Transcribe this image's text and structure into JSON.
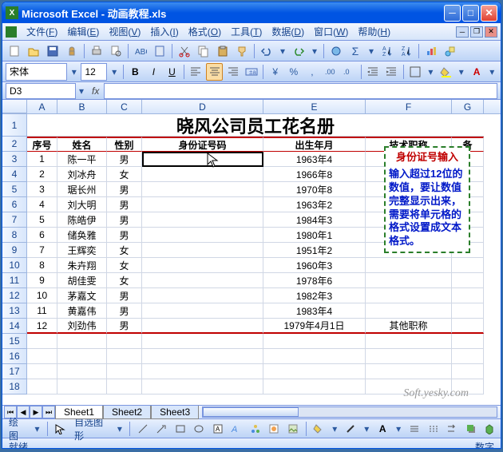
{
  "window": {
    "title": "Microsoft Excel - 动画教程.xls"
  },
  "menus": [
    {
      "label": "文件",
      "key": "F"
    },
    {
      "label": "编辑",
      "key": "E"
    },
    {
      "label": "视图",
      "key": "V"
    },
    {
      "label": "插入",
      "key": "I"
    },
    {
      "label": "格式",
      "key": "O"
    },
    {
      "label": "工具",
      "key": "T"
    },
    {
      "label": "数据",
      "key": "D"
    },
    {
      "label": "窗口",
      "key": "W"
    },
    {
      "label": "帮助",
      "key": "H"
    }
  ],
  "format": {
    "font_name": "宋体",
    "font_size": "12"
  },
  "namebox": {
    "value": "D3"
  },
  "columns": [
    "A",
    "B",
    "C",
    "D",
    "E",
    "F",
    "G"
  ],
  "col_widths": [
    "col-A",
    "col-B",
    "col-C",
    "col-D",
    "col-E",
    "col-F",
    "col-G"
  ],
  "sheet_title": "晓风公司员工花名册",
  "headers": [
    "序号",
    "姓名",
    "性别",
    "身份证号码",
    "出生年月",
    "技术职称",
    "备"
  ],
  "rows": [
    [
      "1",
      "陈一平",
      "男",
      "",
      "1963年4",
      ""
    ],
    [
      "2",
      "刘冰舟",
      "女",
      "",
      "1966年8",
      ""
    ],
    [
      "3",
      "琚长州",
      "男",
      "",
      "1970年8",
      ""
    ],
    [
      "4",
      "刘大明",
      "男",
      "",
      "1963年2",
      ""
    ],
    [
      "5",
      "陈皓伊",
      "男",
      "",
      "1984年3",
      ""
    ],
    [
      "6",
      "储奂雅",
      "男",
      "",
      "1980年1",
      ""
    ],
    [
      "7",
      "王辉奕",
      "女",
      "",
      "1951年2",
      ""
    ],
    [
      "8",
      "朱卉翔",
      "女",
      "",
      "1960年3",
      ""
    ],
    [
      "9",
      "胡佳雯",
      "女",
      "",
      "1978年6",
      ""
    ],
    [
      "10",
      "茅嘉文",
      "男",
      "",
      "1982年3",
      ""
    ],
    [
      "11",
      "黄嘉伟",
      "男",
      "",
      "1983年4",
      ""
    ],
    [
      "12",
      "刘劲伟",
      "男",
      "",
      "1979年4月1日",
      "其他职称"
    ]
  ],
  "tooltip": {
    "title": "身份证号输入",
    "body": "输入超过12位的数值，要让数值完整显示出来，需要将单元格的格式设置成文本格式。"
  },
  "sheets": [
    "Sheet1",
    "Sheet2",
    "Sheet3"
  ],
  "active_sheet": 0,
  "drawbar": {
    "label": "绘图",
    "autoshape": "自选图形"
  },
  "statusbar": {
    "left": "就绪",
    "right": "数字"
  },
  "watermark": "Soft.yesky.com",
  "chart_data": null
}
